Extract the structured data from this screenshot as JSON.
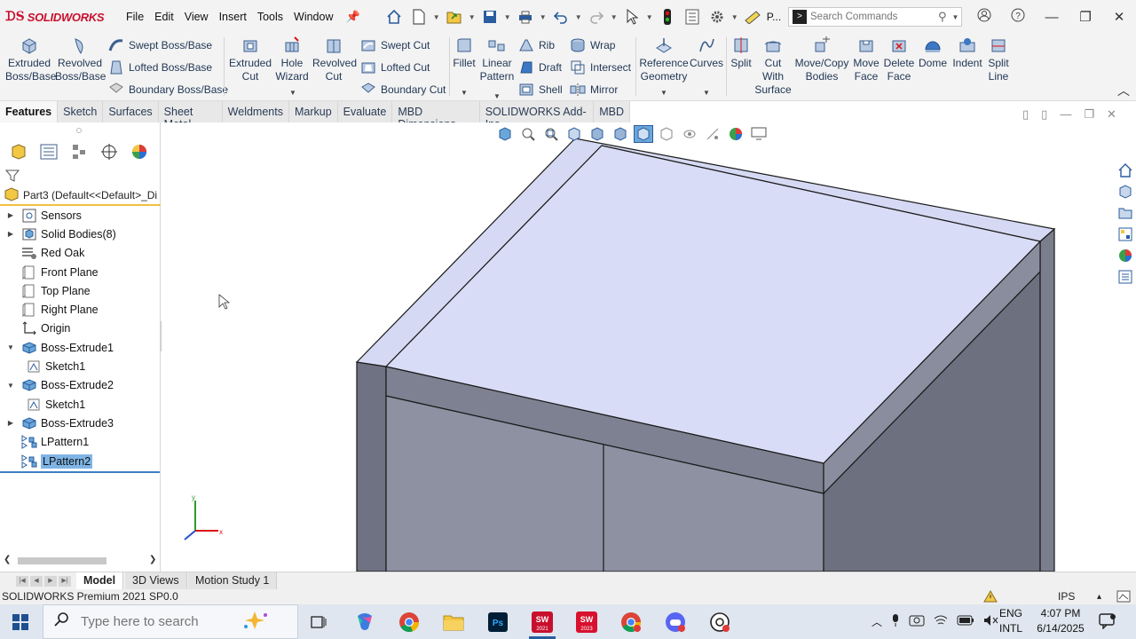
{
  "app": {
    "logo_text": "SOLIDWORKS",
    "menu": [
      "File",
      "Edit",
      "View",
      "Insert",
      "Tools",
      "Window"
    ],
    "p_label": "P...",
    "search_placeholder": "Search Commands"
  },
  "commands": {
    "extruded_boss": [
      "Extruded",
      "Boss/Base"
    ],
    "revolved_boss": [
      "Revolved",
      "Boss/Base"
    ],
    "swept_boss": "Swept Boss/Base",
    "lofted_boss": "Lofted Boss/Base",
    "boundary_boss": "Boundary Boss/Base",
    "extruded_cut": [
      "Extruded",
      "Cut"
    ],
    "hole_wizard": [
      "Hole",
      "Wizard"
    ],
    "revolved_cut": [
      "Revolved",
      "Cut"
    ],
    "swept_cut": "Swept Cut",
    "lofted_cut": "Lofted Cut",
    "boundary_cut": "Boundary Cut",
    "fillet": "Fillet",
    "linear_pattern": [
      "Linear",
      "Pattern"
    ],
    "rib": "Rib",
    "draft": "Draft",
    "shell": "Shell",
    "wrap": "Wrap",
    "intersect": "Intersect",
    "mirror": "Mirror",
    "reference_geometry": [
      "Reference",
      "Geometry"
    ],
    "curves": "Curves",
    "split": "Split",
    "cut_with_surface": [
      "Cut",
      "With",
      "Surface"
    ],
    "move_copy_bodies": [
      "Move/Copy",
      "Bodies"
    ],
    "move_face": [
      "Move",
      "Face"
    ],
    "delete_face": [
      "Delete",
      "Face"
    ],
    "dome": "Dome",
    "indent": "Indent",
    "split_line": [
      "Split",
      "Line"
    ]
  },
  "tabs": [
    "Features",
    "Sketch",
    "Surfaces",
    "Sheet Metal",
    "Weldments",
    "Markup",
    "Evaluate",
    "MBD Dimensions",
    "SOLIDWORKS Add-Ins",
    "MBD"
  ],
  "tree": {
    "part_label": "Part3  (Default<<Default>_Di",
    "nodes": [
      {
        "label": "Sensors",
        "expander": "▶",
        "icon": "sensor-icon"
      },
      {
        "label": "Solid Bodies(8)",
        "expander": "▶",
        "icon": "solid-bodies-icon"
      },
      {
        "label": "Red Oak",
        "expander": "",
        "icon": "material-icon"
      },
      {
        "label": "Front Plane",
        "expander": "",
        "icon": "plane-icon"
      },
      {
        "label": "Top Plane",
        "expander": "",
        "icon": "plane-icon"
      },
      {
        "label": "Right Plane",
        "expander": "",
        "icon": "plane-icon"
      },
      {
        "label": "Origin",
        "expander": "",
        "icon": "origin-icon"
      },
      {
        "label": "Boss-Extrude1",
        "expander": "▼",
        "icon": "extrude-icon"
      },
      {
        "label": "Sketch1",
        "expander": "",
        "icon": "sketch-icon",
        "child": true
      },
      {
        "label": "Boss-Extrude2",
        "expander": "▼",
        "icon": "extrude-icon"
      },
      {
        "label": "Sketch1",
        "expander": "",
        "icon": "sketch-icon",
        "child": true
      },
      {
        "label": "Boss-Extrude3",
        "expander": "▶",
        "icon": "extrude-icon"
      },
      {
        "label": "LPattern1",
        "expander": "",
        "icon": "pattern-icon"
      },
      {
        "label": "LPattern2",
        "expander": "",
        "icon": "pattern-icon",
        "selected": true
      }
    ]
  },
  "bottom_tabs": [
    "Model",
    "3D Views",
    "Motion Study 1"
  ],
  "status": {
    "version": "SOLIDWORKS Premium 2021 SP0.0",
    "units": "IPS"
  },
  "taskbar": {
    "search_placeholder": "Type here to search",
    "sw_2021": "2021",
    "sw_2023": "2023",
    "lang_top": "ENG",
    "lang_bottom": "INTL",
    "time": "4:07 PM",
    "date": "6/14/2025"
  },
  "colors": {
    "brand_red": "#c8102e",
    "accent_blue": "#2a5d9f",
    "selection": "#7fb5e6",
    "top_face": "#d9dcf6",
    "front_face": "#7e8191",
    "side_face": "#6d707f"
  }
}
